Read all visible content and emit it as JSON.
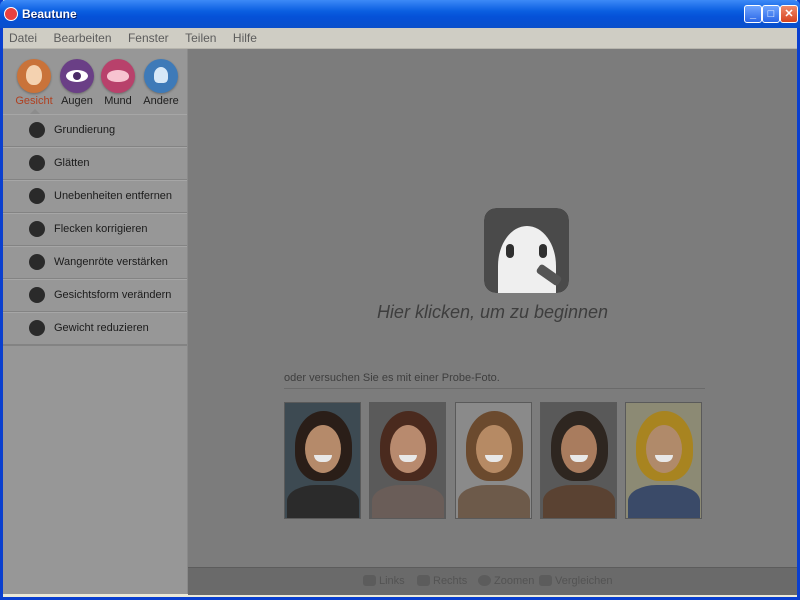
{
  "window": {
    "title": "Beautune"
  },
  "menu": [
    "Datei",
    "Bearbeiten",
    "Fenster",
    "Teilen",
    "Hilfe"
  ],
  "categories": [
    {
      "label": "Gesicht",
      "icon": "face-icon",
      "active": true
    },
    {
      "label": "Augen",
      "icon": "eye-icon",
      "active": false
    },
    {
      "label": "Mund",
      "icon": "lips-icon",
      "active": false
    },
    {
      "label": "Andere",
      "icon": "flower-icon",
      "active": false
    }
  ],
  "tools": [
    {
      "label": "Grundierung",
      "icon": "foundation-icon"
    },
    {
      "label": "Glätten",
      "icon": "smooth-face-icon"
    },
    {
      "label": "Unebenheiten entfernen",
      "icon": "blemish-icon"
    },
    {
      "label": "Flecken korrigieren",
      "icon": "spot-icon"
    },
    {
      "label": "Wangenröte verstärken",
      "icon": "blush-icon"
    },
    {
      "label": "Gesichtsform verändern",
      "icon": "face-shape-icon"
    },
    {
      "label": "Gewicht reduzieren",
      "icon": "weight-icon"
    }
  ],
  "main": {
    "start_text": "Hier klicken, um zu beginnen",
    "sample_label": "oder versuchen Sie es mit einer Probe-Foto."
  },
  "samples": [
    {
      "bg": "#3d4a52",
      "hair": "#2a1e18",
      "face": "#b58a6a",
      "body": "#2b2b2b"
    },
    {
      "bg": "#5a5a5a",
      "hair": "#4a2a1e",
      "face": "#b88a6e",
      "body": "#6a5d58"
    },
    {
      "bg": "#8a8a8a",
      "hair": "#6b4a2e",
      "face": "#b68a64",
      "body": "#6d5a4a"
    },
    {
      "bg": "#595959",
      "hair": "#2e2620",
      "face": "#a97c5e",
      "body": "#5a4232"
    },
    {
      "bg": "#8c8a74",
      "hair": "#a88420",
      "face": "#b08a6a",
      "body": "#3a4a68"
    }
  ],
  "bottombar": {
    "left": "Links",
    "right": "Rechts",
    "zoom": "Zoomen",
    "compare": "Vergleichen"
  }
}
